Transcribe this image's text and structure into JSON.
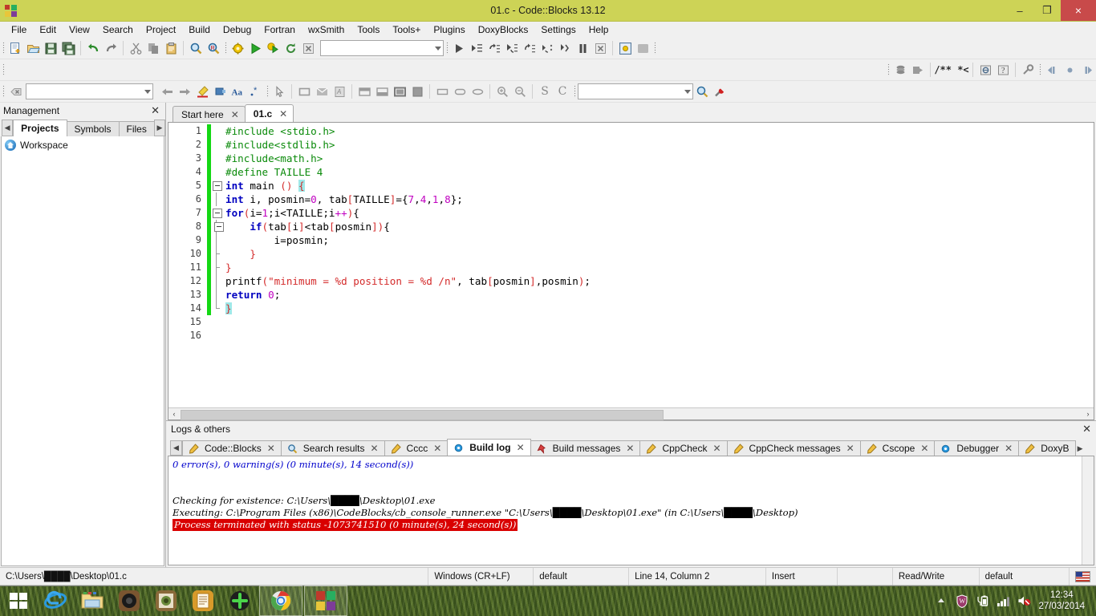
{
  "window": {
    "title": "01.c - Code::Blocks 13.12",
    "minimize_label": "–",
    "maximize_label": "❐",
    "close_label": "×"
  },
  "menubar": {
    "items": [
      "File",
      "Edit",
      "View",
      "Search",
      "Project",
      "Build",
      "Debug",
      "Fortran",
      "wxSmith",
      "Tools",
      "Tools+",
      "Plugins",
      "DoxyBlocks",
      "Settings",
      "Help"
    ]
  },
  "toolbars": {
    "row1": {
      "main_icons": [
        "new-file-icon",
        "open-file-icon",
        "save-icon",
        "save-all-icon",
        "undo-icon",
        "redo-icon",
        "cut-icon",
        "copy-icon",
        "paste-icon",
        "find-icon",
        "replace-icon"
      ],
      "build_icons": [
        "build-icon",
        "run-icon",
        "build-and-run-icon",
        "rebuild-icon",
        "abort-icon"
      ],
      "target_combo_value": "",
      "debug_icons": [
        "debug-continue-icon",
        "debug-run-to-cursor-icon",
        "debug-next-line-icon",
        "debug-step-into-icon",
        "debug-step-out-icon",
        "debug-next-instruction-icon",
        "debug-step-into-instruction-icon",
        "debug-break-icon",
        "debug-stop-icon"
      ],
      "debug_window_icons": [
        "debugging-windows-icon",
        "various-info-icon"
      ]
    },
    "row2": {
      "left_icons": [
        "back-icon",
        "forward-icon"
      ],
      "doxy_icons": [
        "doxyblocks-run-icon",
        "doxyblocks-extract-icon"
      ],
      "comment_label": "/** *<",
      "misc_icons": [
        "doxyblocks-help-icon",
        "doxyblocks-about-icon",
        "doxyblocks-config-icon"
      ],
      "nav_icons": [
        "jump-back-icon",
        "jump-home-icon",
        "jump-forward-icon"
      ]
    },
    "row3": {
      "close_icon": "clear-icon",
      "search_value": "",
      "nav_icons": [
        "previous-icon",
        "next-icon",
        "highlight-icon",
        "bookmark-icon",
        "match-case-icon",
        "regex-icon"
      ],
      "pointer_icon": "select-pointer-icon",
      "wx_icons": [
        "wx-panel-icon",
        "wx-dialog-icon",
        "wx-frame-icon",
        "wx-topbar-icon",
        "wx-bottombar-icon",
        "wx-statusbar-icon",
        "wx-fill-icon",
        "wx-box-icon",
        "wx-rounded-icon",
        "wx-ellipse-icon"
      ],
      "zoom_in_icon": "zoom-in-icon",
      "zoom_out_icon": "zoom-out-icon",
      "s_label": "S",
      "c_label": "C",
      "scope_combo_value": "",
      "scope_search_icon": "scope-search-icon",
      "scope_tool_icon": "scope-settings-icon"
    }
  },
  "management": {
    "title": "Management",
    "close_label": "✕",
    "tabs": [
      {
        "label": "Projects",
        "active": true
      },
      {
        "label": "Symbols",
        "active": false
      },
      {
        "label": "Files",
        "active": false
      }
    ],
    "prev_arrow": "◀",
    "next_arrow": "▶",
    "tree": [
      {
        "label": "Workspace",
        "icon": "workspace-home-icon"
      }
    ]
  },
  "editor": {
    "tabs": [
      {
        "label": "Start here",
        "active": false,
        "close": "✕"
      },
      {
        "label": "01.c",
        "active": true,
        "close": "✕"
      }
    ],
    "line_numbers": [
      1,
      2,
      3,
      4,
      5,
      6,
      7,
      8,
      9,
      10,
      11,
      12,
      13,
      14,
      15,
      16
    ],
    "modified_lines": [
      1,
      2,
      3,
      4,
      5,
      6,
      7,
      8,
      9,
      10,
      11,
      12,
      13,
      14
    ],
    "lines": [
      {
        "n": 1,
        "text": "#include <stdio.h>"
      },
      {
        "n": 2,
        "text": "#include<stdlib.h>"
      },
      {
        "n": 3,
        "text": "#include<math.h>"
      },
      {
        "n": 4,
        "text": "#define TAILLE 4"
      },
      {
        "n": 5,
        "text": "int main () {"
      },
      {
        "n": 6,
        "text": "int i, posmin=0, tab[TAILLE]={7,4,1,8};"
      },
      {
        "n": 7,
        "text": "for(i=1;i<TAILLE;i++){"
      },
      {
        "n": 8,
        "text": "    if(tab[i]<tab[posmin]){"
      },
      {
        "n": 9,
        "text": "        i=posmin;"
      },
      {
        "n": 10,
        "text": "    }"
      },
      {
        "n": 11,
        "text": "}"
      },
      {
        "n": 12,
        "text": "printf(\"minimum = %d position = %d /n\", tab[posmin],posmin);"
      },
      {
        "n": 13,
        "text": "return 0;"
      },
      {
        "n": 14,
        "text": "}"
      },
      {
        "n": 15,
        "text": ""
      },
      {
        "n": 16,
        "text": ""
      }
    ],
    "hscroll_left": "‹",
    "hscroll_right": "›"
  },
  "logs": {
    "title": "Logs & others",
    "close_label": "✕",
    "prev_arrow": "◀",
    "next_arrow": "▶",
    "tabs": [
      {
        "label": "Code::Blocks",
        "icon": "pencil-icon",
        "active": false,
        "close": "✕"
      },
      {
        "label": "Search results",
        "icon": "magnifier-icon",
        "active": false,
        "close": "✕"
      },
      {
        "label": "Cccc",
        "icon": "pencil-icon",
        "active": false,
        "close": "✕"
      },
      {
        "label": "Build log",
        "icon": "gear-blue-icon",
        "active": true,
        "close": "✕"
      },
      {
        "label": "Build messages",
        "icon": "pin-icon",
        "active": false,
        "close": "✕"
      },
      {
        "label": "CppCheck",
        "icon": "pencil-icon",
        "active": false,
        "close": "✕"
      },
      {
        "label": "CppCheck messages",
        "icon": "pencil-icon",
        "active": false,
        "close": "✕"
      },
      {
        "label": "Cscope",
        "icon": "pencil-icon",
        "active": false,
        "close": "✕"
      },
      {
        "label": "Debugger",
        "icon": "gear-blue-icon",
        "active": false,
        "close": "✕"
      },
      {
        "label": "DoxyB",
        "icon": "pencil-icon",
        "active": false,
        "close": ""
      }
    ],
    "content": [
      {
        "text": "0 error(s), 0 warning(s) (0 minute(s), 14 second(s))",
        "style": "blue"
      },
      {
        "text": "",
        "style": "plain"
      },
      {
        "text": "",
        "style": "plain"
      },
      {
        "text": "Checking for existence: C:\\Users\\████\\Desktop\\01.exe",
        "style": "plain"
      },
      {
        "text": "Executing: C:\\Program Files (x86)\\CodeBlocks/cb_console_runner.exe \"C:\\Users\\████\\Desktop\\01.exe\" (in C:\\Users\\████\\Desktop)",
        "style": "plain"
      },
      {
        "text": "Process terminated with status -1073741510 (0 minute(s), 24 second(s))",
        "style": "error"
      }
    ]
  },
  "statusbar": {
    "path": "C:\\Users\\████\\Desktop\\01.c",
    "eol": "Windows (CR+LF)",
    "encoding": "default",
    "position": "Line 14, Column 2",
    "insert_mode": "Insert",
    "blank": "",
    "access": "Read/Write",
    "profile": "default",
    "keyboard_icon": "us-flag-icon"
  },
  "taskbar": {
    "start_label": "start-button",
    "items": [
      {
        "name": "internet-explorer-icon",
        "pinned": false
      },
      {
        "name": "file-explorer-icon",
        "pinned": false
      },
      {
        "name": "media-player-icon",
        "pinned": false
      },
      {
        "name": "photo-viewer-icon",
        "pinned": false
      },
      {
        "name": "notes-app-icon",
        "pinned": false
      },
      {
        "name": "game-controller-icon",
        "pinned": false
      },
      {
        "name": "google-chrome-icon",
        "pinned": true
      },
      {
        "name": "codeblocks-icon",
        "pinned": true
      }
    ],
    "tray": [
      "show-hidden-icons-arrow",
      "antivirus-shield-icon",
      "battery-icon",
      "network-signal-icon",
      "volume-muted-icon"
    ],
    "clock_time": "12:34",
    "clock_date": "27/03/2014"
  },
  "colors": {
    "titlebar": "#cdd356",
    "close_button": "#c84a4a",
    "keyword": "#0000c0",
    "preprocessor": "#0a8a0a",
    "string": "#d42b2b",
    "number": "#c000c0",
    "bracket_match": "#9fe8e8",
    "change_bar": "#14d814",
    "log_error_bg": "#d90000",
    "log_info": "#0000cc"
  }
}
